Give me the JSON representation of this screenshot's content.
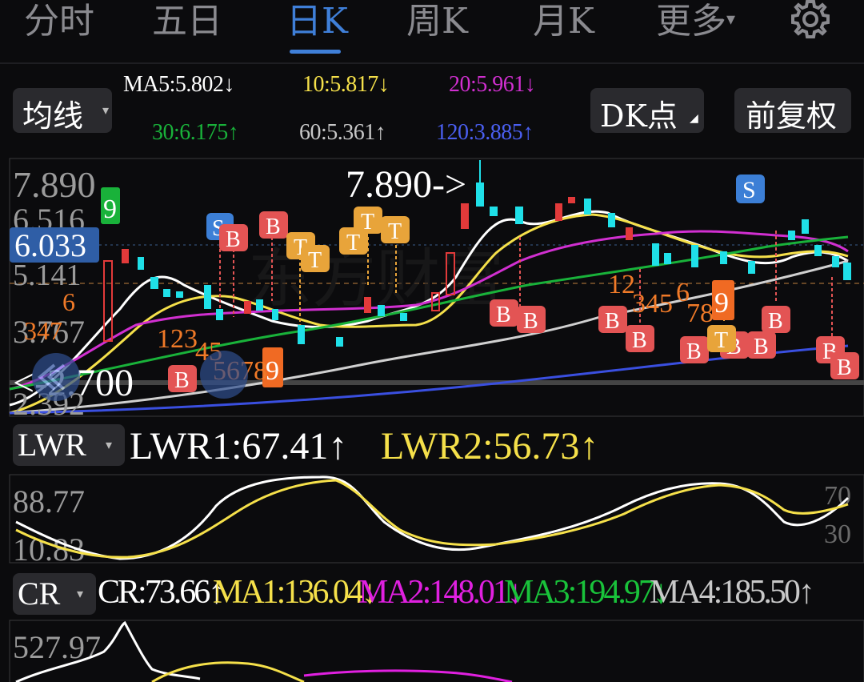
{
  "tabs": [
    {
      "label": "分时"
    },
    {
      "label": "五日"
    },
    {
      "label": "日K"
    },
    {
      "label": "周K"
    },
    {
      "label": "月K"
    },
    {
      "label": "更多"
    }
  ],
  "more_arrow": "▾",
  "toolbar": {
    "ma_button": "均线",
    "dk_button": "DK点",
    "adjust_button": "前复权"
  },
  "ma_legend": [
    {
      "text": "MA5:5.802",
      "arrow": "↓",
      "color": "#ffffff"
    },
    {
      "text": "10:5.817",
      "arrow": "↓",
      "color": "#f5e04a"
    },
    {
      "text": "20:5.961",
      "arrow": "↓",
      "color": "#d12fd0"
    },
    {
      "text": "30:6.175",
      "arrow": "↑",
      "color": "#19b23a"
    },
    {
      "text": "60:5.361",
      "arrow": "↑",
      "color": "#c8c8c8"
    },
    {
      "text": "120:3.885",
      "arrow": "↑",
      "color": "#3a4fe0"
    }
  ],
  "main_chart": {
    "axis_labels": [
      "7.890",
      "6.516",
      "6.033",
      "5.141",
      "3.767",
      "2.392"
    ],
    "high_annotation": "7.890->",
    "low_annotation": "<-2.700",
    "last_price_label": "6.033",
    "signals": {
      "s_label": "S",
      "b_label": "B",
      "t_label": "T",
      "nine": "9"
    },
    "watermark": "东方财富"
  },
  "lwr": {
    "selector": "LWR",
    "lwr1": "LWR1:67.41",
    "lwr1_arrow": "↑",
    "lwr2": "LWR2:56.73",
    "lwr2_arrow": "↑",
    "axis_high": "88.77",
    "axis_low": "10.83",
    "right_high": "70",
    "right_low": "30"
  },
  "cr": {
    "selector": "CR",
    "values": [
      {
        "text": "CR:73.66",
        "arrow": "↑",
        "color": "#ffffff"
      },
      {
        "text": "MA1:136.04",
        "arrow": "↓",
        "color": "#f5e04a"
      },
      {
        "text": "MA2:148.01",
        "arrow": "↓",
        "color": "#e020e0"
      },
      {
        "text": "MA3:194.97",
        "arrow": "↓",
        "color": "#19c23a"
      },
      {
        "text": "MA4:185.50",
        "arrow": "↑",
        "color": "#c8c8c8"
      }
    ],
    "axis_high": "527.97"
  },
  "colors": {
    "up": "#e23a3a",
    "down": "#1fe0e8",
    "accent": "#3f7fd8",
    "signal_b": "#e35454",
    "signal_t": "#e8a43a",
    "signal_s": "#3c7fd6",
    "nine": "#f06a23"
  }
}
